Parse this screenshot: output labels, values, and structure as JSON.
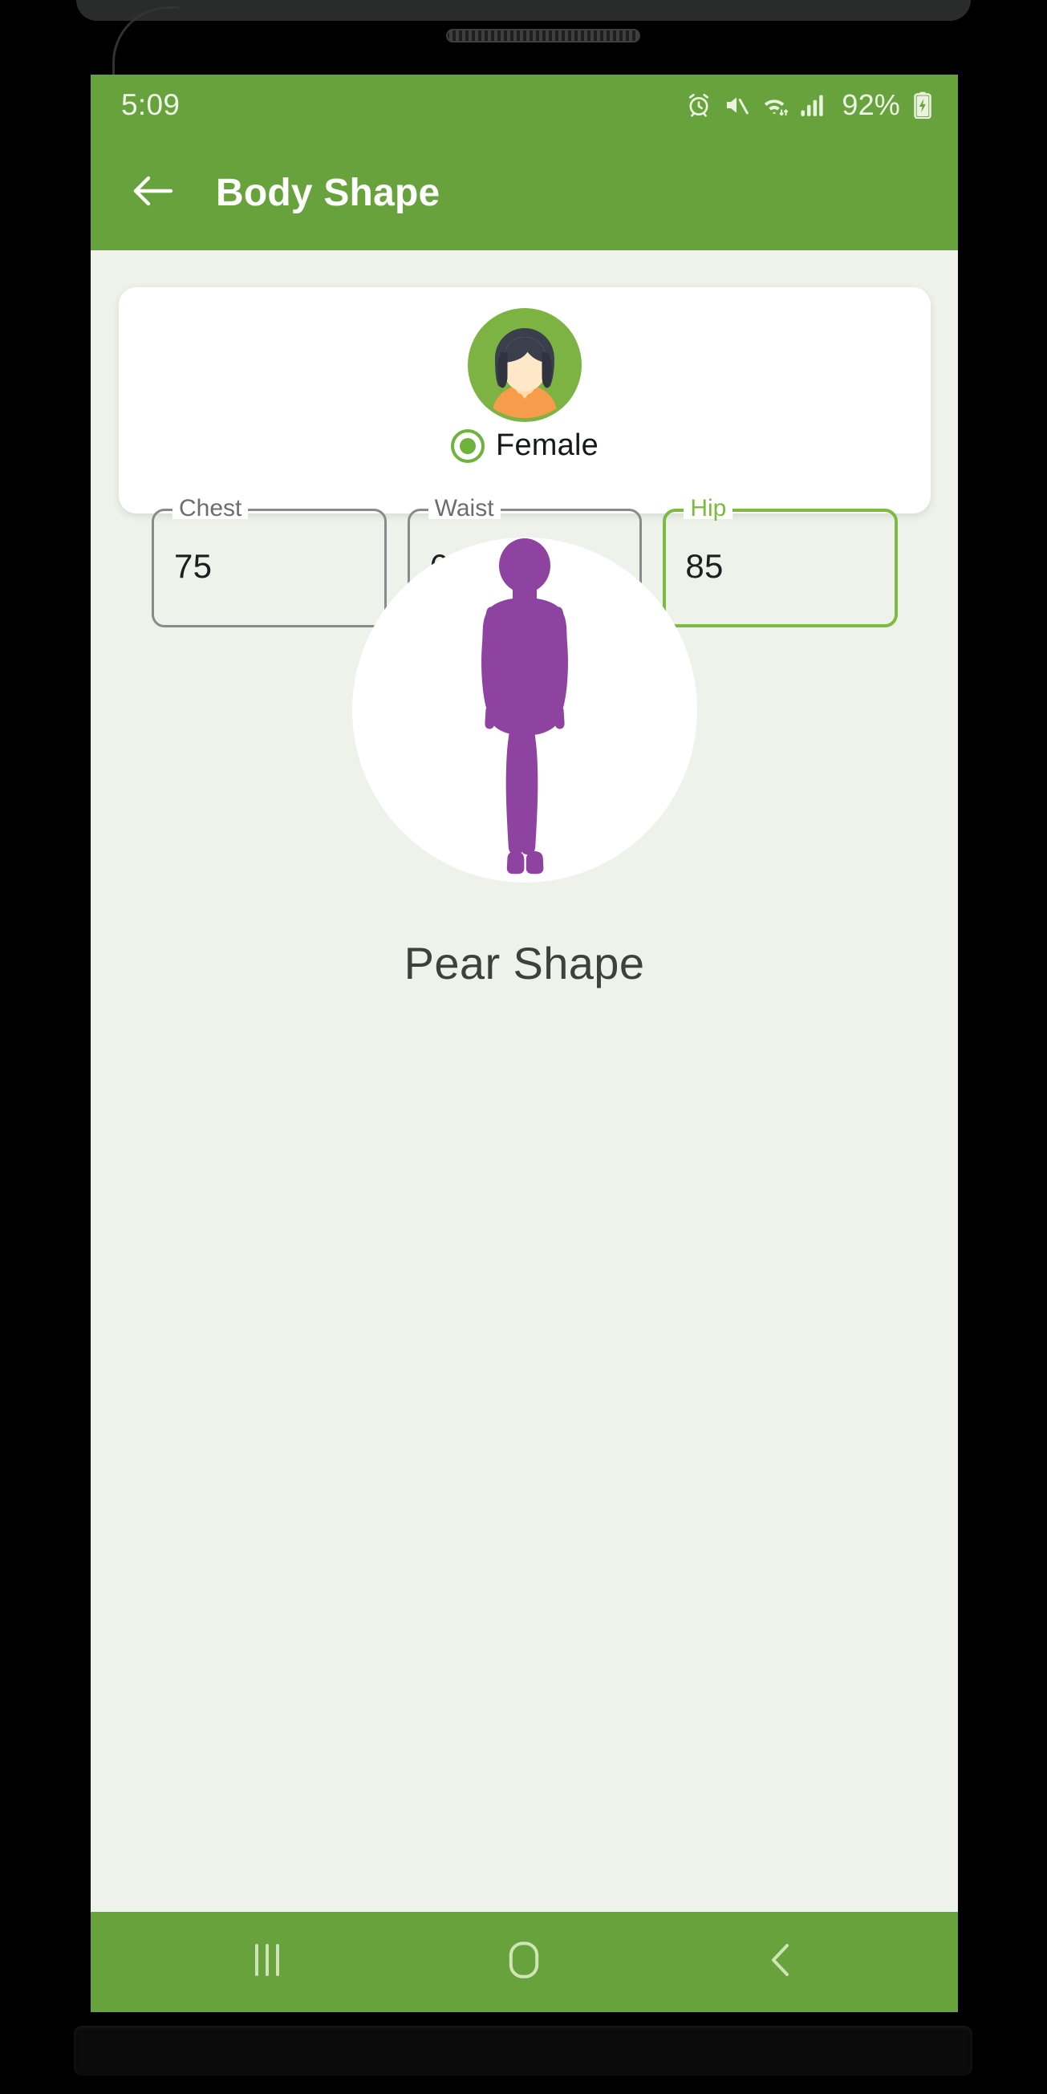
{
  "status_bar": {
    "time": "5:09",
    "battery_percent": "92%",
    "icons": [
      "alarm-icon",
      "mute-icon",
      "wifi-icon",
      "cellular-signal-icon",
      "battery-charging-icon"
    ]
  },
  "app_bar": {
    "back_icon": "back-arrow-icon",
    "title": "Body Shape"
  },
  "card": {
    "avatar_icon": "female-avatar-icon",
    "gender": {
      "label": "Female",
      "selected": true,
      "accent_color": "#6fb33f"
    },
    "fields": [
      {
        "label": "Chest",
        "value": "75",
        "focused": false
      },
      {
        "label": "Waist",
        "value": "60",
        "focused": false
      },
      {
        "label": "Hip",
        "value": "85",
        "focused": true
      }
    ]
  },
  "result": {
    "figure_icon": "female-body-silhouette-icon",
    "figure_color": "#8e43a0",
    "shape_name": "Pear Shape"
  },
  "nav_bar": {
    "recents_icon": "recents-icon",
    "home_icon": "home-icon",
    "back_icon": "nav-back-icon"
  },
  "colors": {
    "primary_green": "#67a23c",
    "accent_green": "#7cbb42",
    "screen_background": "#eef2ea",
    "card_background": "#ffffff",
    "text_dark": "#3c413c"
  }
}
